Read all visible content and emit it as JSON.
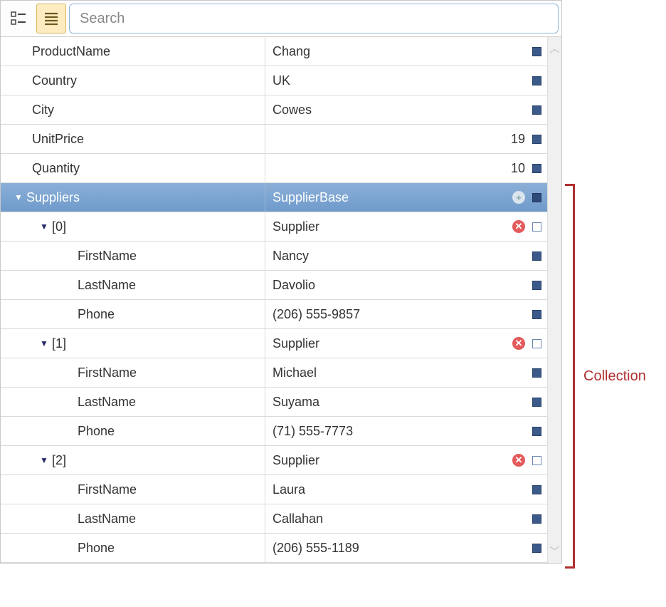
{
  "toolbar": {
    "search_placeholder": "Search"
  },
  "rows": [
    {
      "kind": "prop",
      "indent": 1,
      "name": "ProductName",
      "value": "Chang",
      "align": "left"
    },
    {
      "kind": "prop",
      "indent": 1,
      "name": "Country",
      "value": "UK",
      "align": "left"
    },
    {
      "kind": "prop",
      "indent": 1,
      "name": "City",
      "value": "Cowes",
      "align": "left"
    },
    {
      "kind": "prop",
      "indent": 1,
      "name": "UnitPrice",
      "value": "19",
      "align": "right"
    },
    {
      "kind": "prop",
      "indent": 1,
      "name": "Quantity",
      "value": "10",
      "align": "right"
    },
    {
      "kind": "group",
      "indent": 0,
      "name": "Suppliers",
      "value": "SupplierBase",
      "selected": true,
      "add": true
    },
    {
      "kind": "item",
      "indent": 1,
      "name": "[0]",
      "value": "Supplier",
      "del": true
    },
    {
      "kind": "prop",
      "indent": 3,
      "name": "FirstName",
      "value": "Nancy",
      "align": "left"
    },
    {
      "kind": "prop",
      "indent": 3,
      "name": "LastName",
      "value": "Davolio",
      "align": "left"
    },
    {
      "kind": "prop",
      "indent": 3,
      "name": "Phone",
      "value": "(206) 555-9857",
      "align": "left"
    },
    {
      "kind": "item",
      "indent": 1,
      "name": "[1]",
      "value": "Supplier",
      "del": true
    },
    {
      "kind": "prop",
      "indent": 3,
      "name": "FirstName",
      "value": "Michael",
      "align": "left"
    },
    {
      "kind": "prop",
      "indent": 3,
      "name": "LastName",
      "value": "Suyama",
      "align": "left"
    },
    {
      "kind": "prop",
      "indent": 3,
      "name": "Phone",
      "value": "(71) 555-7773",
      "align": "left"
    },
    {
      "kind": "item",
      "indent": 1,
      "name": "[2]",
      "value": "Supplier",
      "del": true
    },
    {
      "kind": "prop",
      "indent": 3,
      "name": "FirstName",
      "value": "Laura",
      "align": "left"
    },
    {
      "kind": "prop",
      "indent": 3,
      "name": "LastName",
      "value": "Callahan",
      "align": "left"
    },
    {
      "kind": "prop",
      "indent": 3,
      "name": "Phone",
      "value": "(206) 555-1189",
      "align": "left"
    }
  ],
  "annotation": {
    "label": "Collection"
  }
}
